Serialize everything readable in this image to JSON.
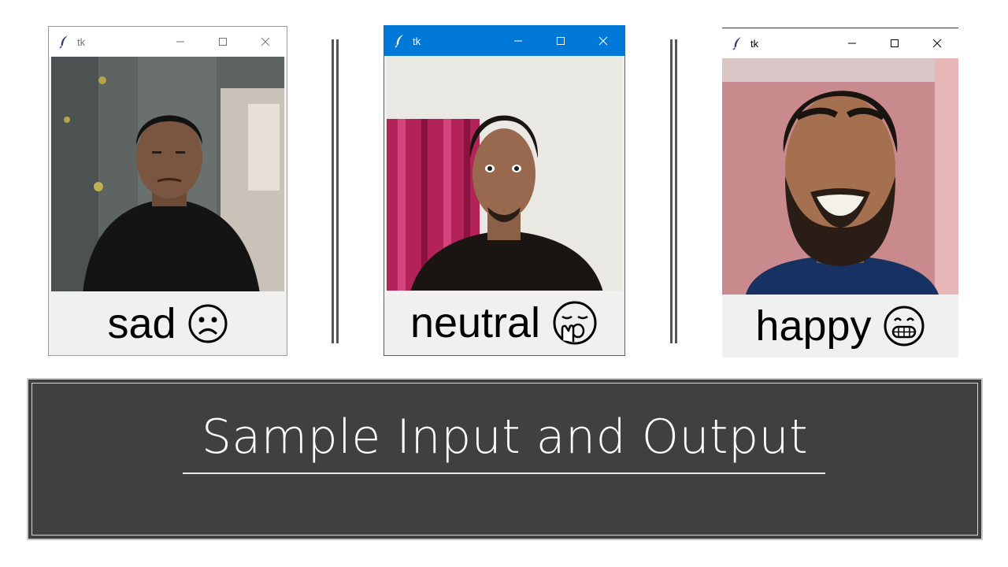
{
  "windows": [
    {
      "title": "tk",
      "active": false,
      "label": "sad",
      "emoji": "sad-face-icon"
    },
    {
      "title": "tk",
      "active": true,
      "label": "neutral",
      "emoji": "yawning-face-icon"
    },
    {
      "title": "tk",
      "active": false,
      "label": "happy",
      "emoji": "grinning-face-icon"
    }
  ],
  "window_controls": [
    "minimize",
    "maximize",
    "close"
  ],
  "banner": {
    "title": "Sample Input and Output"
  },
  "colors": {
    "active_titlebar": "#0078d7",
    "banner_bg": "#404040",
    "text": "#000000"
  }
}
